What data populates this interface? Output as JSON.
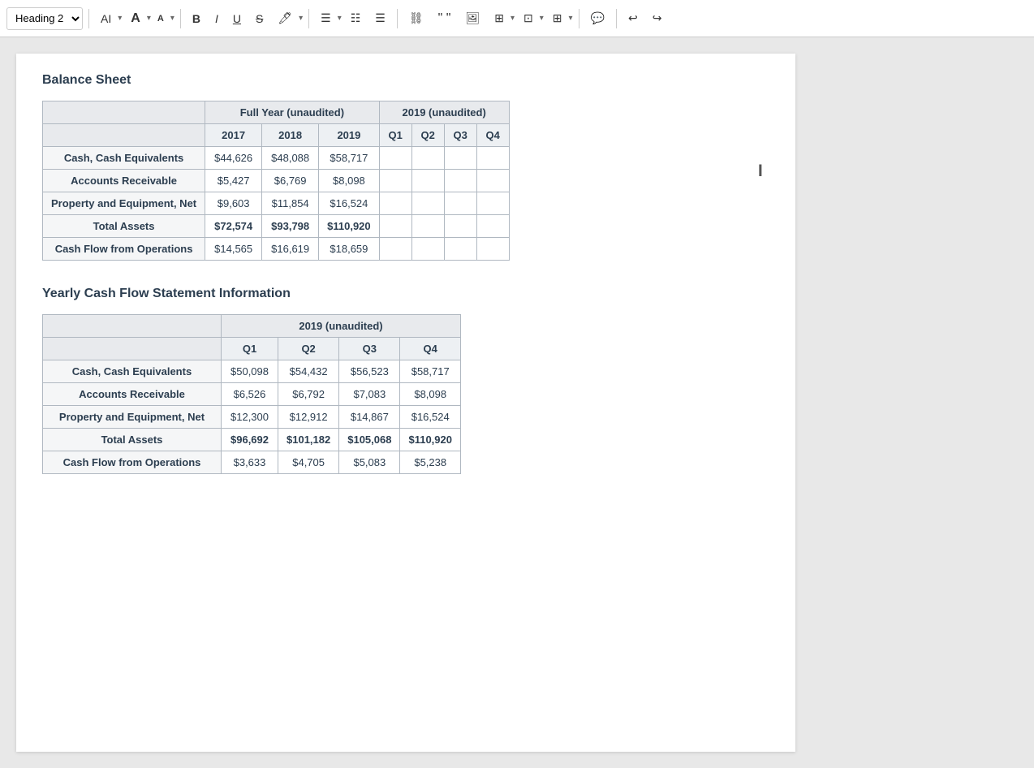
{
  "toolbar": {
    "heading_select": "Heading 2",
    "ai_label": "AI",
    "font_size_label": "A",
    "font_size_smaller": "A",
    "bold": "B",
    "italic": "I",
    "underline": "U",
    "strikethrough": "S",
    "highlight": "🖊",
    "align": "≡",
    "ordered_list": "≔",
    "unordered_list": "≔",
    "link": "🔗",
    "quote": "❝❞",
    "image": "🖼",
    "table": "⊞",
    "embed": "⊡",
    "special": "⊞",
    "comment": "💬",
    "undo": "↩",
    "redo": "↪"
  },
  "balance_sheet": {
    "heading": "Balance Sheet",
    "col_group1_label": "Full Year (unaudited)",
    "col_group2_label": "2019 (unaudited)",
    "col_2017": "2017",
    "col_2018": "2018",
    "col_2019": "2019",
    "col_q1": "Q1",
    "col_q2": "Q2",
    "col_q3": "Q3",
    "col_q4": "Q4",
    "rows": [
      {
        "label": "Cash, Cash Equivalents",
        "v2017": "$44,626",
        "v2018": "$48,088",
        "v2019": "$58,717",
        "q1": "",
        "q2": "",
        "q3": "",
        "q4": ""
      },
      {
        "label": "Accounts Receivable",
        "v2017": "$5,427",
        "v2018": "$6,769",
        "v2019": "$8,098",
        "q1": "",
        "q2": "",
        "q3": "",
        "q4": ""
      },
      {
        "label": "Property and Equipment, Net",
        "v2017": "$9,603",
        "v2018": "$11,854",
        "v2019": "$16,524",
        "q1": "",
        "q2": "",
        "q3": "",
        "q4": ""
      },
      {
        "label": "Total Assets",
        "v2017": "$72,574",
        "v2018": "$93,798",
        "v2019": "$110,920",
        "q1": "",
        "q2": "",
        "q3": "",
        "q4": "",
        "is_total": true
      },
      {
        "label": "Cash Flow from Operations",
        "v2017": "$14,565",
        "v2018": "$16,619",
        "v2019": "$18,659",
        "q1": "",
        "q2": "",
        "q3": "",
        "q4": ""
      }
    ]
  },
  "cash_flow": {
    "heading": "Yearly Cash Flow Statement Information",
    "col_group1_label": "2019 (unaudited)",
    "col_q1": "Q1",
    "col_q2": "Q2",
    "col_q3": "Q3",
    "col_q4": "Q4",
    "rows": [
      {
        "label": "Cash, Cash Equivalents",
        "q1": "$50,098",
        "q2": "$54,432",
        "q3": "$56,523",
        "q4": "$58,717"
      },
      {
        "label": "Accounts Receivable",
        "q1": "$6,526",
        "q2": "$6,792",
        "q3": "$7,083",
        "q4": "$8,098"
      },
      {
        "label": "Property and Equipment, Net",
        "q1": "$12,300",
        "q2": "$12,912",
        "q3": "$14,867",
        "q4": "$16,524"
      },
      {
        "label": "Total Assets",
        "q1": "$96,692",
        "q2": "$101,182",
        "q3": "$105,068",
        "q4": "$110,920",
        "is_total": true
      },
      {
        "label": "Cash Flow from Operations",
        "q1": "$3,633",
        "q2": "$4,705",
        "q3": "$5,083",
        "q4": "$5,238"
      }
    ]
  }
}
